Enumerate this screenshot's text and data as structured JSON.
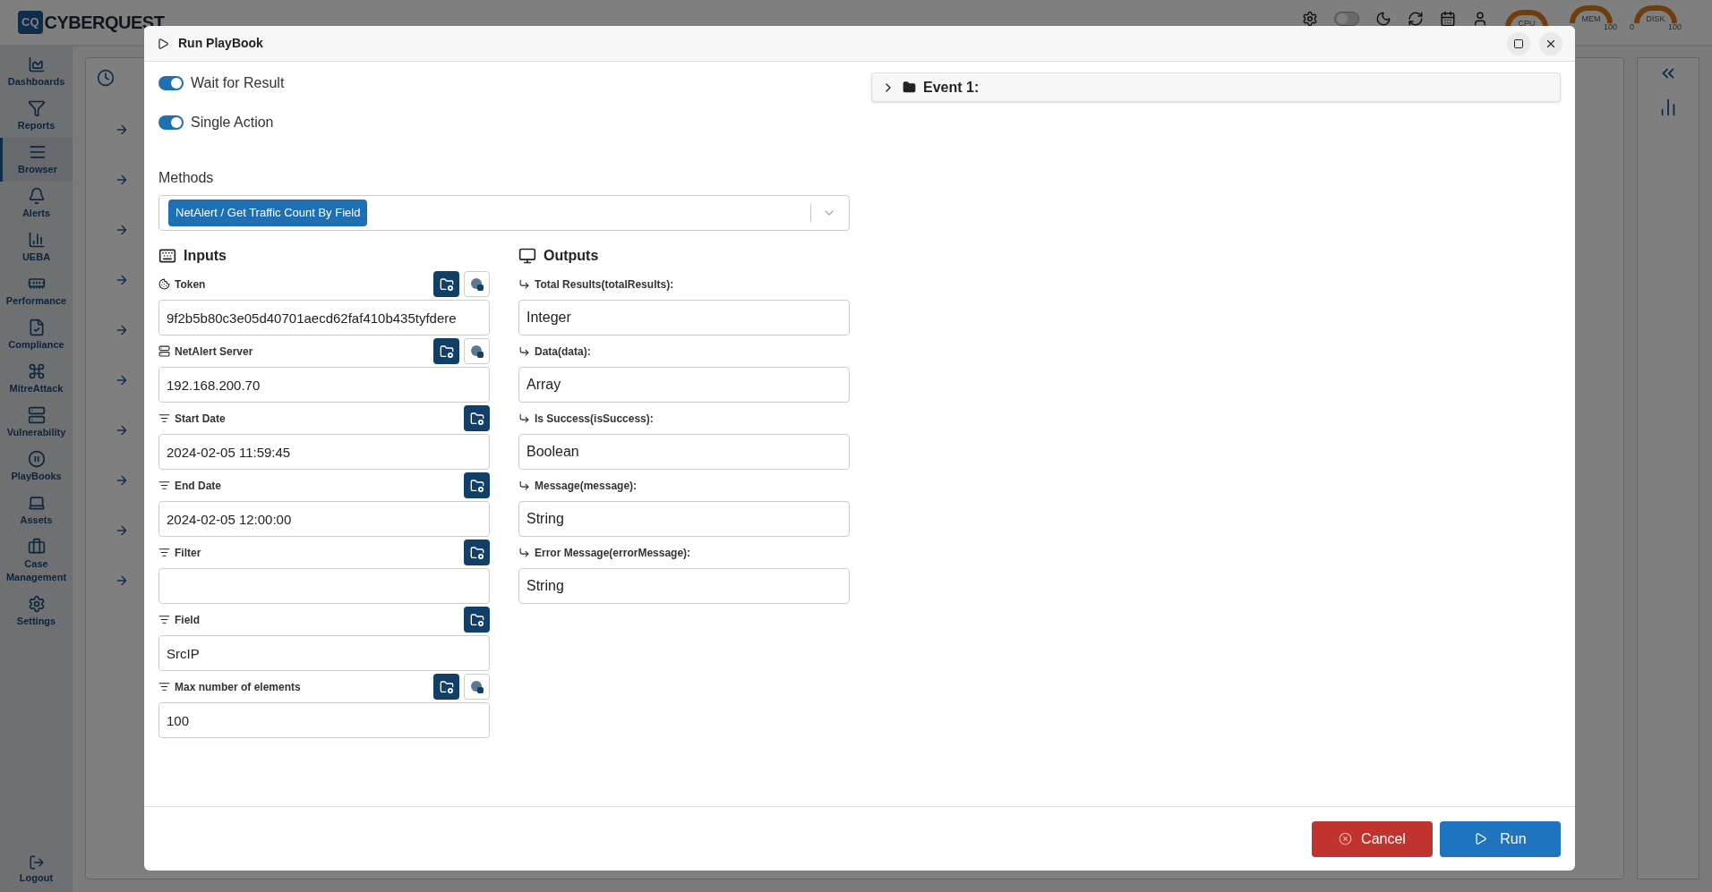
{
  "app": {
    "logo_mark": "CQ",
    "logo_text": "CYBERQUEST",
    "dark_mode": {
      "on": false
    },
    "gauges": [
      {
        "label": "CPU"
      },
      {
        "label": "MEM",
        "ticks": [
          "100"
        ]
      },
      {
        "label": "DISK",
        "ticks": [
          "0",
          "100"
        ]
      }
    ]
  },
  "sidebar": {
    "items": [
      {
        "label": "Dashboards",
        "selected": false
      },
      {
        "label": "Reports",
        "selected": false
      },
      {
        "label": "Browser",
        "selected": true
      },
      {
        "label": "Alerts",
        "selected": false
      },
      {
        "label": "UEBA",
        "selected": false
      },
      {
        "label": "Performance",
        "selected": false
      },
      {
        "label": "Compliance",
        "selected": false
      },
      {
        "label": "MitreAttack",
        "selected": false
      },
      {
        "label": "Vulnerability",
        "selected": false
      },
      {
        "label": "PlayBooks",
        "selected": false
      },
      {
        "label": "Assets",
        "selected": false
      },
      {
        "label": "Case Management",
        "selected": false
      },
      {
        "label": "Settings",
        "selected": false
      }
    ],
    "logout": "Logout"
  },
  "modal": {
    "title": "Run PlayBook",
    "toggles": [
      {
        "label": "Wait for Result",
        "on": true
      },
      {
        "label": "Single Action",
        "on": true
      }
    ],
    "methods": {
      "label": "Methods",
      "chips": [
        "NetAlert / Get Traffic Count By Field"
      ]
    },
    "inputs": {
      "title": "Inputs",
      "fields": [
        {
          "kind": "token",
          "label": "Token",
          "value": "9f2b5b80c3e05d40701aecd62faf410b435tyfdere",
          "extra_button": true
        },
        {
          "kind": "server",
          "label": "NetAlert Server",
          "value": "192.168.200.70",
          "extra_button": true
        },
        {
          "kind": "filter",
          "label": "Start Date",
          "value": "2024-02-05 11:59:45",
          "extra_button": false
        },
        {
          "kind": "filter",
          "label": "End Date",
          "value": "2024-02-05 12:00:00",
          "extra_button": false
        },
        {
          "kind": "filter",
          "label": "Filter",
          "extra_button": false
        },
        {
          "kind": "filter",
          "label": "Field",
          "value": "SrcIP",
          "extra_button": false
        },
        {
          "kind": "filter",
          "label": "Max number of elements",
          "value": "100",
          "extra_button": true
        }
      ]
    },
    "outputs": {
      "title": "Outputs",
      "fields": [
        {
          "label": "Total Results(totalResults):",
          "value": "Integer"
        },
        {
          "label": "Data(data):",
          "value": "Array"
        },
        {
          "label": "Is Success(isSuccess):",
          "value": "Boolean"
        },
        {
          "label": "Message(message):",
          "value": "String"
        },
        {
          "label": "Error Message(errorMessage):",
          "value": "String"
        }
      ]
    },
    "event": {
      "label": "Event 1:",
      "expanded": false
    },
    "buttons": {
      "cancel": "Cancel",
      "run": "Run"
    }
  }
}
